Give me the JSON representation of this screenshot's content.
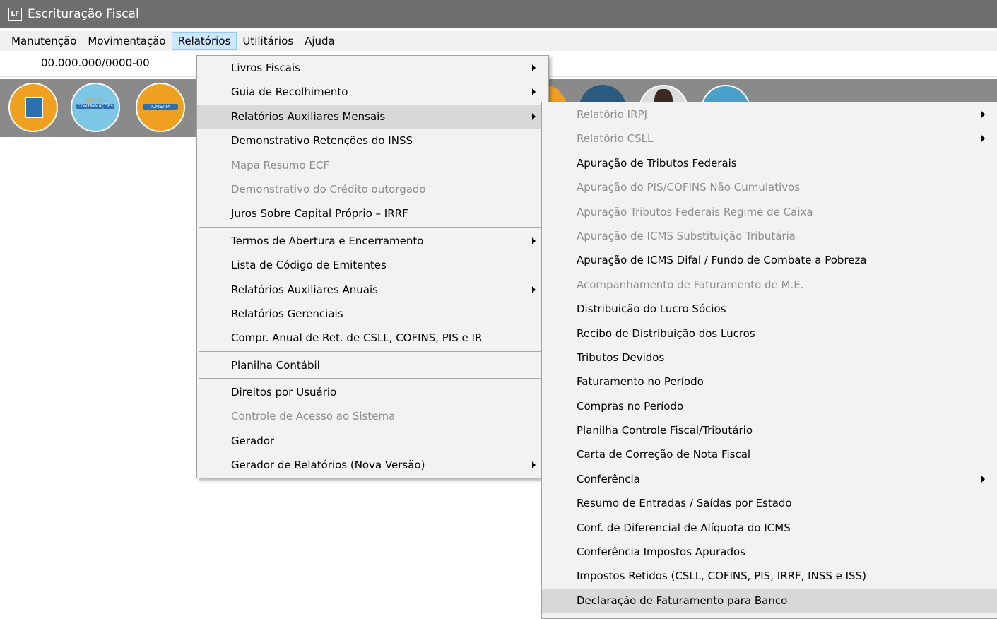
{
  "window": {
    "icon_text": "LF",
    "title": "Escrituração Fiscal"
  },
  "menubar": {
    "items": [
      "Manutenção",
      "Movimentação",
      "Relatórios",
      "Utilitários",
      "Ajuda"
    ],
    "active_index": 2
  },
  "company": {
    "cnpj": "00.000.000/0000-00"
  },
  "toolbar": {
    "icons": [
      "building-icon",
      "sped-contribuicoes-icon",
      "icms-ipi-icon"
    ],
    "sped_label": "SPED",
    "contrib_label": "CONTRIBUIÇÕES",
    "icms_label": "ICMS/IPI"
  },
  "relatorios_menu": {
    "items": [
      {
        "label": "Livros Fiscais",
        "submenu": true,
        "disabled": false
      },
      {
        "label": "Guia de Recolhimento",
        "submenu": true,
        "disabled": false
      },
      {
        "label": "Relatórios Auxiliares Mensais",
        "submenu": true,
        "disabled": false,
        "highlighted": true
      },
      {
        "label": "Demonstrativo Retenções do INSS",
        "submenu": false,
        "disabled": false
      },
      {
        "label": "Mapa Resumo ECF",
        "submenu": false,
        "disabled": true
      },
      {
        "label": "Demonstrativo do Crédito outorgado",
        "submenu": false,
        "disabled": true
      },
      {
        "label": "Juros Sobre Capital Próprio – IRRF",
        "submenu": false,
        "disabled": false
      },
      {
        "label": "Termos de Abertura e Encerramento",
        "submenu": true,
        "disabled": false
      },
      {
        "label": "Lista de Código de Emitentes",
        "submenu": false,
        "disabled": false
      },
      {
        "label": "Relatórios Auxiliares Anuais",
        "submenu": true,
        "disabled": false
      },
      {
        "label": "Relatórios Gerenciais",
        "submenu": false,
        "disabled": false
      },
      {
        "label": "Compr. Anual de Ret. de CSLL, COFINS,  PIS e IR",
        "submenu": false,
        "disabled": false
      },
      {
        "label": "Planilha Contábil",
        "submenu": false,
        "disabled": false
      },
      {
        "label": "Direitos por Usuário",
        "submenu": false,
        "disabled": false
      },
      {
        "label": "Controle de Acesso ao Sistema",
        "submenu": false,
        "disabled": true
      },
      {
        "label": "Gerador",
        "submenu": false,
        "disabled": false
      },
      {
        "label": "Gerador de Relatórios (Nova Versão)",
        "submenu": true,
        "disabled": false
      }
    ],
    "separators_after": [
      6,
      11,
      12
    ]
  },
  "mensais_submenu": {
    "items": [
      {
        "label": "Relatório IRPJ",
        "submenu": true,
        "disabled": true
      },
      {
        "label": "Relatório CSLL",
        "submenu": true,
        "disabled": true
      },
      {
        "label": "Apuração de Tributos Federais",
        "submenu": false,
        "disabled": false
      },
      {
        "label": "Apuração do PIS/COFINS Não Cumulativos",
        "submenu": false,
        "disabled": true
      },
      {
        "label": "Apuração Tributos Federais Regime de Caixa",
        "submenu": false,
        "disabled": true
      },
      {
        "label": "Apuração de ICMS Substituição Tributária",
        "submenu": false,
        "disabled": true
      },
      {
        "label": "Apuração de ICMS Difal / Fundo de Combate a Pobreza",
        "submenu": false,
        "disabled": false
      },
      {
        "label": "Acompanhamento de Faturamento de M.E.",
        "submenu": false,
        "disabled": true
      },
      {
        "label": "Distribuição do Lucro Sócios",
        "submenu": false,
        "disabled": false
      },
      {
        "label": "Recibo de Distribuição dos Lucros",
        "submenu": false,
        "disabled": false
      },
      {
        "label": "Tributos Devidos",
        "submenu": false,
        "disabled": false
      },
      {
        "label": "Faturamento no Período",
        "submenu": false,
        "disabled": false
      },
      {
        "label": "Compras no Período",
        "submenu": false,
        "disabled": false
      },
      {
        "label": "Planilha Controle Fiscal/Tributário",
        "submenu": false,
        "disabled": false
      },
      {
        "label": "Carta de Correção de Nota Fiscal",
        "submenu": false,
        "disabled": false
      },
      {
        "label": "Conferência",
        "submenu": true,
        "disabled": false
      },
      {
        "label": "Resumo de Entradas / Saídas por Estado",
        "submenu": false,
        "disabled": false
      },
      {
        "label": "Conf. de Diferencial de Alíquota do ICMS",
        "submenu": false,
        "disabled": false
      },
      {
        "label": "Conferência Impostos Apurados",
        "submenu": false,
        "disabled": false
      },
      {
        "label": "Impostos Retidos (CSLL, COFINS,  PIS, IRRF, INSS e ISS)",
        "submenu": false,
        "disabled": false
      },
      {
        "label": "Declaração de Faturamento para Banco",
        "submenu": false,
        "disabled": false,
        "highlighted": true
      }
    ],
    "separators_after": []
  }
}
